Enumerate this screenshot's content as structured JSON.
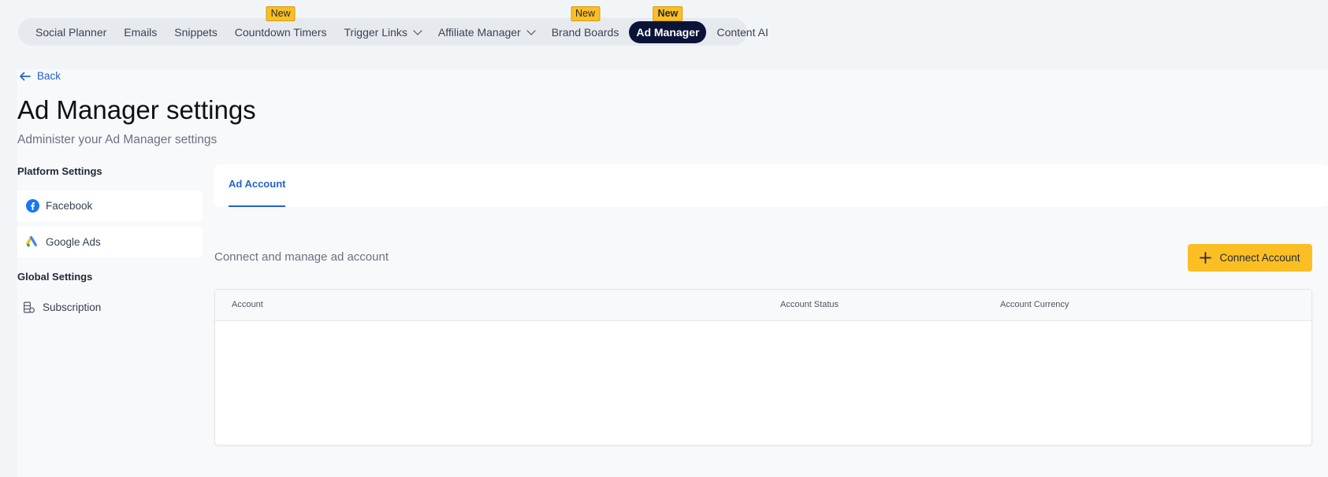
{
  "nav": {
    "items": [
      {
        "label": "Social Planner",
        "badge": "",
        "dropdown": false,
        "active": false
      },
      {
        "label": "Emails",
        "badge": "",
        "dropdown": false,
        "active": false
      },
      {
        "label": "Snippets",
        "badge": "",
        "dropdown": false,
        "active": false
      },
      {
        "label": "Countdown Timers",
        "badge": "New",
        "dropdown": false,
        "active": false
      },
      {
        "label": "Trigger Links",
        "badge": "",
        "dropdown": true,
        "active": false
      },
      {
        "label": "Affiliate Manager",
        "badge": "",
        "dropdown": true,
        "active": false
      },
      {
        "label": "Brand Boards",
        "badge": "New",
        "dropdown": false,
        "active": false
      },
      {
        "label": "Ad Manager",
        "badge": "New",
        "dropdown": false,
        "active": true
      },
      {
        "label": "Content AI",
        "badge": "",
        "dropdown": false,
        "active": false
      }
    ]
  },
  "back_label": "Back",
  "page": {
    "title": "Ad Manager settings",
    "subtitle": "Administer your Ad Manager settings"
  },
  "sidebar": {
    "platform_heading": "Platform Settings",
    "platform_items": [
      {
        "label": "Facebook",
        "icon": "facebook-icon"
      },
      {
        "label": "Google Ads",
        "icon": "google-ads-icon"
      }
    ],
    "global_heading": "Global Settings",
    "global_items": [
      {
        "label": "Subscription",
        "icon": "subscription-icon"
      }
    ]
  },
  "tabs": [
    {
      "label": "Ad Account",
      "active": true
    }
  ],
  "section": {
    "text": "Connect and manage ad account",
    "connect_button": "Connect Account"
  },
  "table": {
    "columns": [
      "Account",
      "Account Status",
      "Account Currency"
    ],
    "rows": []
  },
  "colors": {
    "accent": "#2563c9",
    "active_nav": "#0b1437",
    "badge": "#fbbf24",
    "button": "#fbbf24"
  }
}
